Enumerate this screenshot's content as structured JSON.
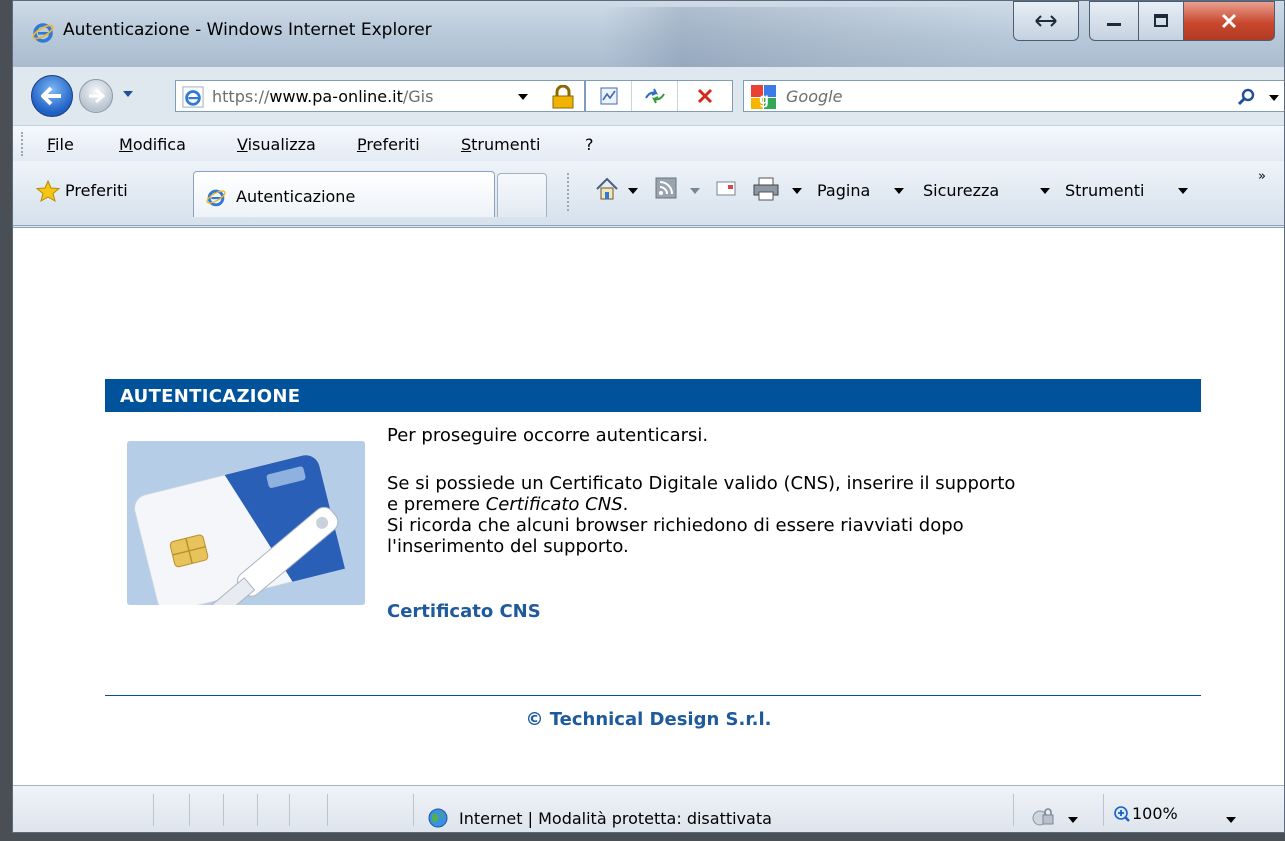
{
  "window": {
    "title": "Autenticazione - Windows Internet Explorer"
  },
  "address_bar": {
    "scheme": "https://",
    "host": "www.pa-online.it",
    "path": "/Gis"
  },
  "search": {
    "placeholder": "Google"
  },
  "menu": {
    "items": [
      "File",
      "Modifica",
      "Visualizza",
      "Preferiti",
      "Strumenti",
      "?"
    ]
  },
  "favorites": {
    "label": "Preferiti"
  },
  "tabs": [
    {
      "label": "Autenticazione",
      "active": true
    }
  ],
  "command_bar": {
    "page_label": "Pagina",
    "security_label": "Sicurezza",
    "tools_label": "Strumenti"
  },
  "page": {
    "header": "AUTENTICAZIONE",
    "intro": "Per proseguire occorre autenticarsi.",
    "para1_a": "Se si possiede un Certificato Digitale valido (CNS), inserire il supporto",
    "para1_b_prefix": "e premere ",
    "para1_b_em": "Certificato CNS",
    "para1_b_suffix": ".",
    "para2_a": "Si ricorda che alcuni browser richiedono di essere riavviati dopo",
    "para2_b": "l'inserimento del supporto.",
    "link_label": "Certificato CNS",
    "footer": "© Technical Design S.r.l."
  },
  "status_bar": {
    "zone_text": "Internet | Modalità protetta: disattivata",
    "zoom": "100%"
  },
  "colors": {
    "brand_blue": "#00529b",
    "link_blue": "#1e5a9c"
  }
}
